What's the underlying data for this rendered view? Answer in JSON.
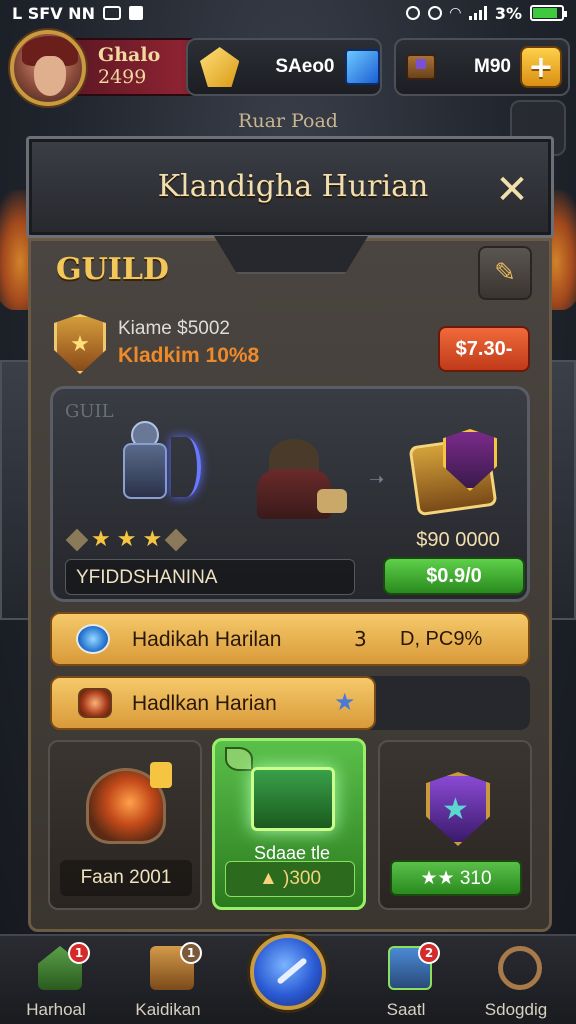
{
  "status_bar": {
    "left_text": "L SFV NN",
    "battery_text": "3%"
  },
  "player": {
    "name": "Ghalo",
    "level": "2499"
  },
  "resources": {
    "currency1_value": "SAeo0",
    "currency2_value": "M90",
    "plus_label": "+"
  },
  "background_title": "Ruar Poad",
  "dialog": {
    "title": "Klandigha Hurian",
    "close_label": "✕",
    "section_label": "GUILD",
    "info_line1": "Kiame $5002",
    "info_line2": "Kladkim 10%8",
    "price_button": "$7.30-",
    "showcase": {
      "watermark": "GUIL",
      "name": "YFIDDSHANINA",
      "treasure_price": "$90 0000",
      "buy_button": "$0.9/0",
      "stars": [
        "★",
        "★",
        "★"
      ]
    },
    "banner1": {
      "label": "Hadikah Harilan",
      "extra": "3",
      "value": "D, PC9%"
    },
    "banner2": {
      "label": "Hadlkan Harian",
      "star": "★"
    },
    "cards": [
      {
        "label": "Faan 2001"
      },
      {
        "sublabel": "Sdaae tle",
        "label": "▲ )300"
      },
      {
        "label": "★★ 310"
      }
    ]
  },
  "bottom_nav": [
    {
      "label": "Harhoal",
      "badge": "1"
    },
    {
      "label": "Kaidikan",
      "badge": "1"
    },
    {
      "label": "Saatl",
      "badge": "2"
    },
    {
      "label": "Sdogdig"
    }
  ],
  "colors": {
    "accent_gold": "#f3c75a",
    "price_red": "#c03a1a",
    "buy_green": "#2a8a1e"
  }
}
